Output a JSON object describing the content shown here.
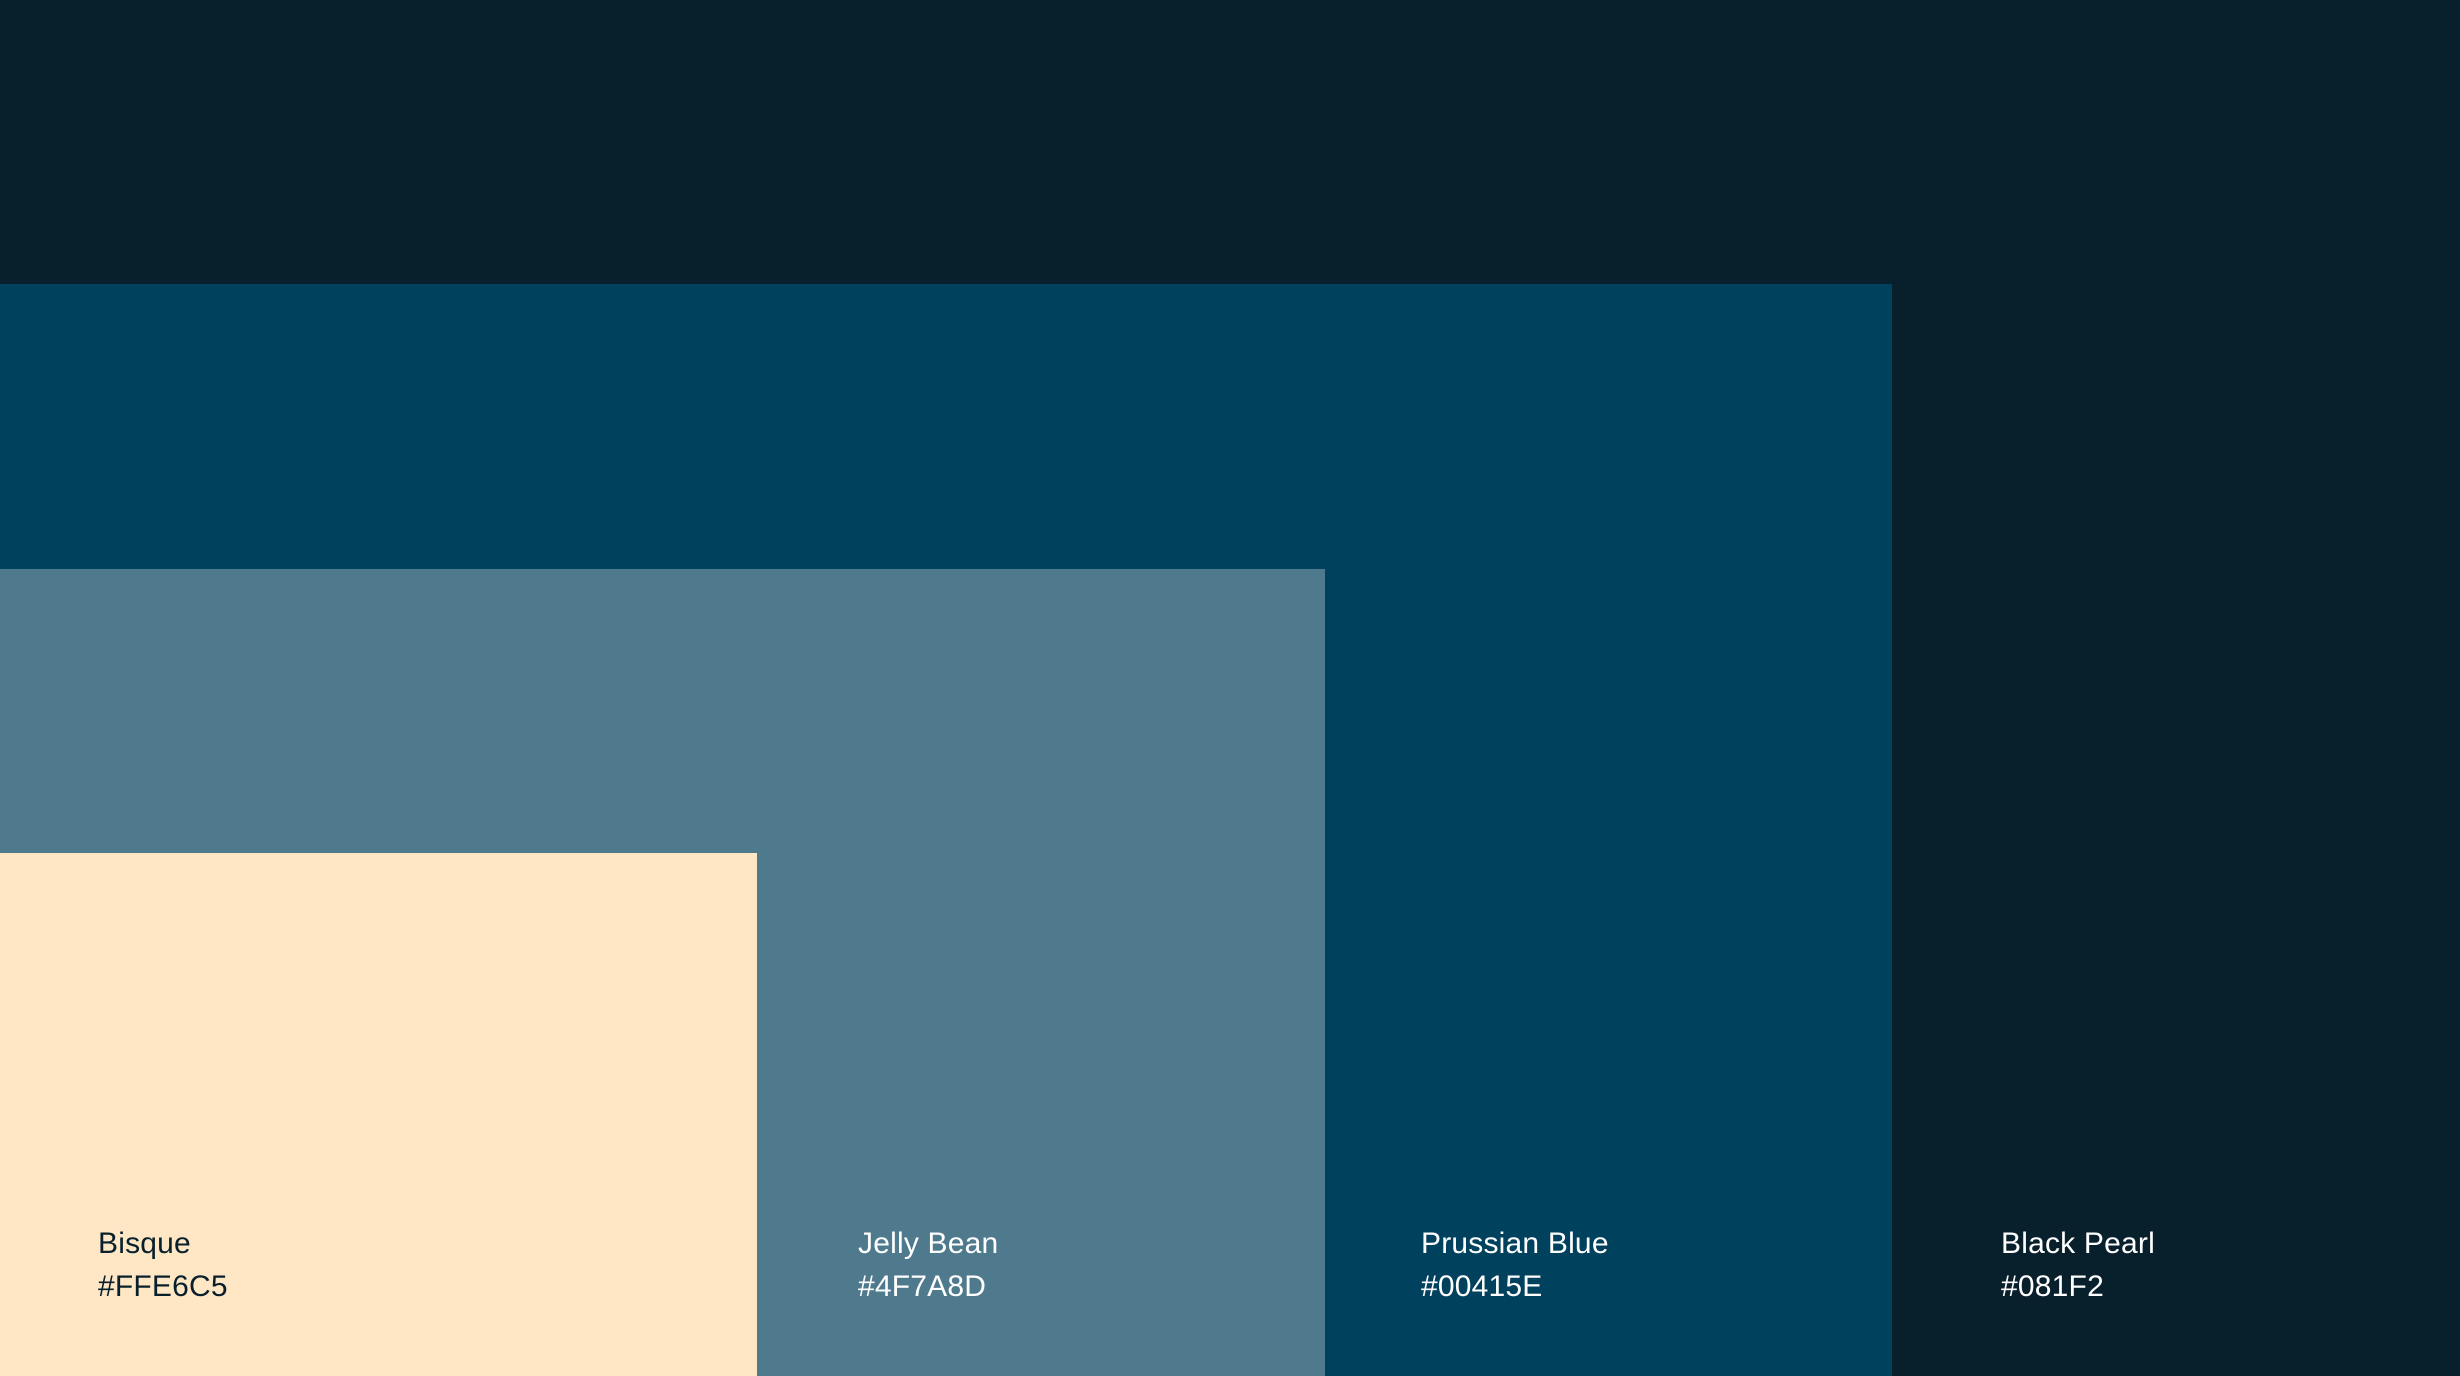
{
  "swatches": [
    {
      "name": "Bisque",
      "hex": "#FFE6C5",
      "color": "#FFE6C5",
      "text_color": "#081F2C"
    },
    {
      "name": "Jelly Bean",
      "hex": "#4F7A8D",
      "color": "#4F7A8D",
      "text_color": "#FFFFFF"
    },
    {
      "name": "Prussian Blue",
      "hex": "#00415E",
      "color": "#00415E",
      "text_color": "#FFFFFF"
    },
    {
      "name": "Black Pearl",
      "hex": "#081F2",
      "color": "#081F2C",
      "text_color": "#FFFFFF"
    }
  ]
}
